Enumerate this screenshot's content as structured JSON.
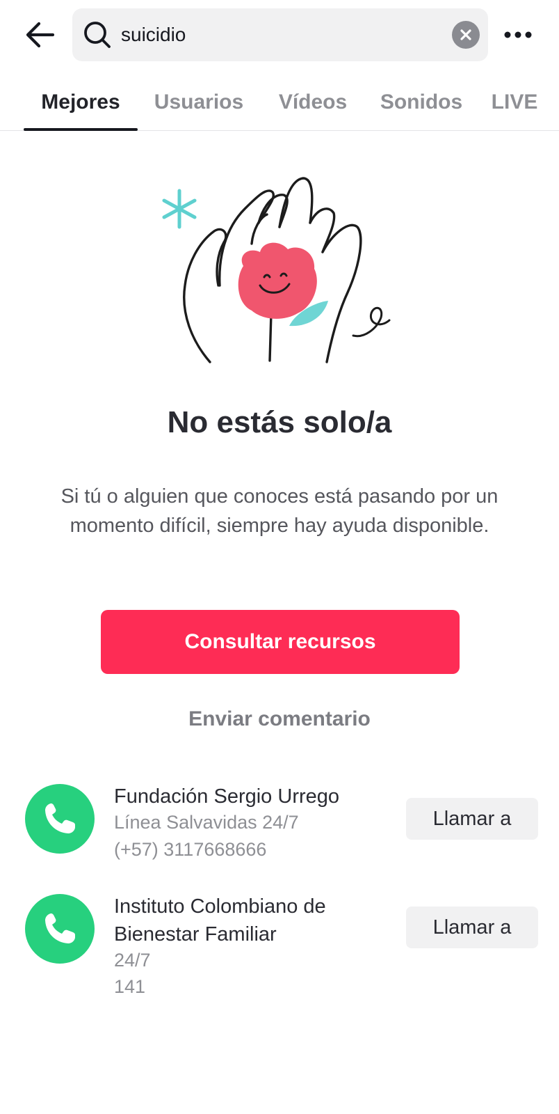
{
  "header": {
    "back_icon": "arrow-left-icon",
    "search": {
      "icon": "search-icon",
      "query": "suicidio",
      "clear_icon": "clear-circle-icon"
    },
    "more_icon": "more-horizontal-icon"
  },
  "tabs": [
    {
      "label": "Mejores",
      "active": true
    },
    {
      "label": "Usuarios",
      "active": false
    },
    {
      "label": "Vídeos",
      "active": false
    },
    {
      "label": "Sonidos",
      "active": false
    },
    {
      "label": "LIVE",
      "active": false
    }
  ],
  "illustration": {
    "icon": "hands-holding-flower-illustration",
    "colors": {
      "flower": "#f0566e",
      "leaf": "#5fd0cf",
      "sparkle": "#5fd0cf"
    }
  },
  "support": {
    "headline": "No estás solo/a",
    "body": "Si tú o alguien que conoces está pasando por un momento difícil, siempre hay ayuda disponible.",
    "primary_button": "Consultar recursos",
    "secondary_link": "Enviar comentario"
  },
  "hotlines": [
    {
      "name": "Fundación Sergio Urrego",
      "subtitle": "Línea Salvavidas 24/7",
      "phone": "(+57) 3117668666",
      "call_label": "Llamar a",
      "icon": "phone-icon"
    },
    {
      "name": "Instituto Colombiano de Bienestar Familiar",
      "subtitle": "24/7",
      "phone": "141",
      "call_label": "Llamar a",
      "icon": "phone-icon"
    }
  ],
  "colors": {
    "accent": "#fe2c55",
    "phone_green": "#27d07e",
    "text_primary": "#2a2b32",
    "text_secondary": "#8e8f94"
  }
}
